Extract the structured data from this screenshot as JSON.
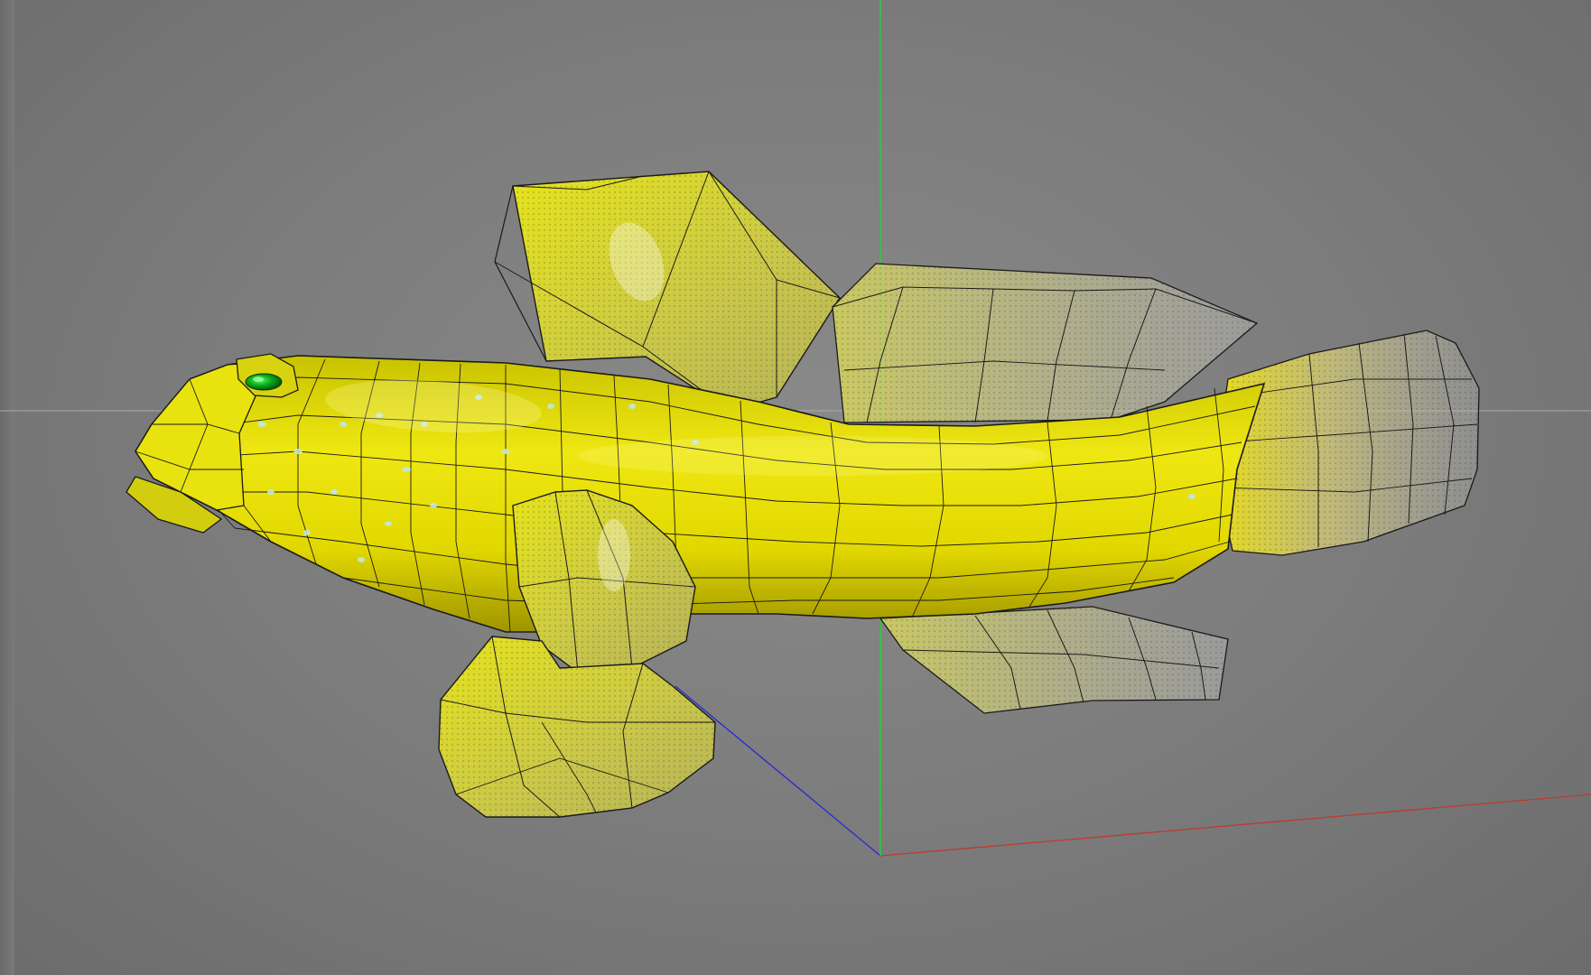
{
  "viewport": {
    "background_color": "#7c7c7c",
    "view": "3d-perspective",
    "axes": {
      "x_color": "#c0392b",
      "y_color": "#2ecc40",
      "z_color": "#2a2ad0"
    }
  },
  "model": {
    "subject": "fish",
    "body_color": "#e3dc0a",
    "fin_color": "#d8d86a",
    "eye_color": "#0a9a1a",
    "wireframe_color": "#1a1a1a",
    "display_mode": "textured-with-wireframe"
  }
}
